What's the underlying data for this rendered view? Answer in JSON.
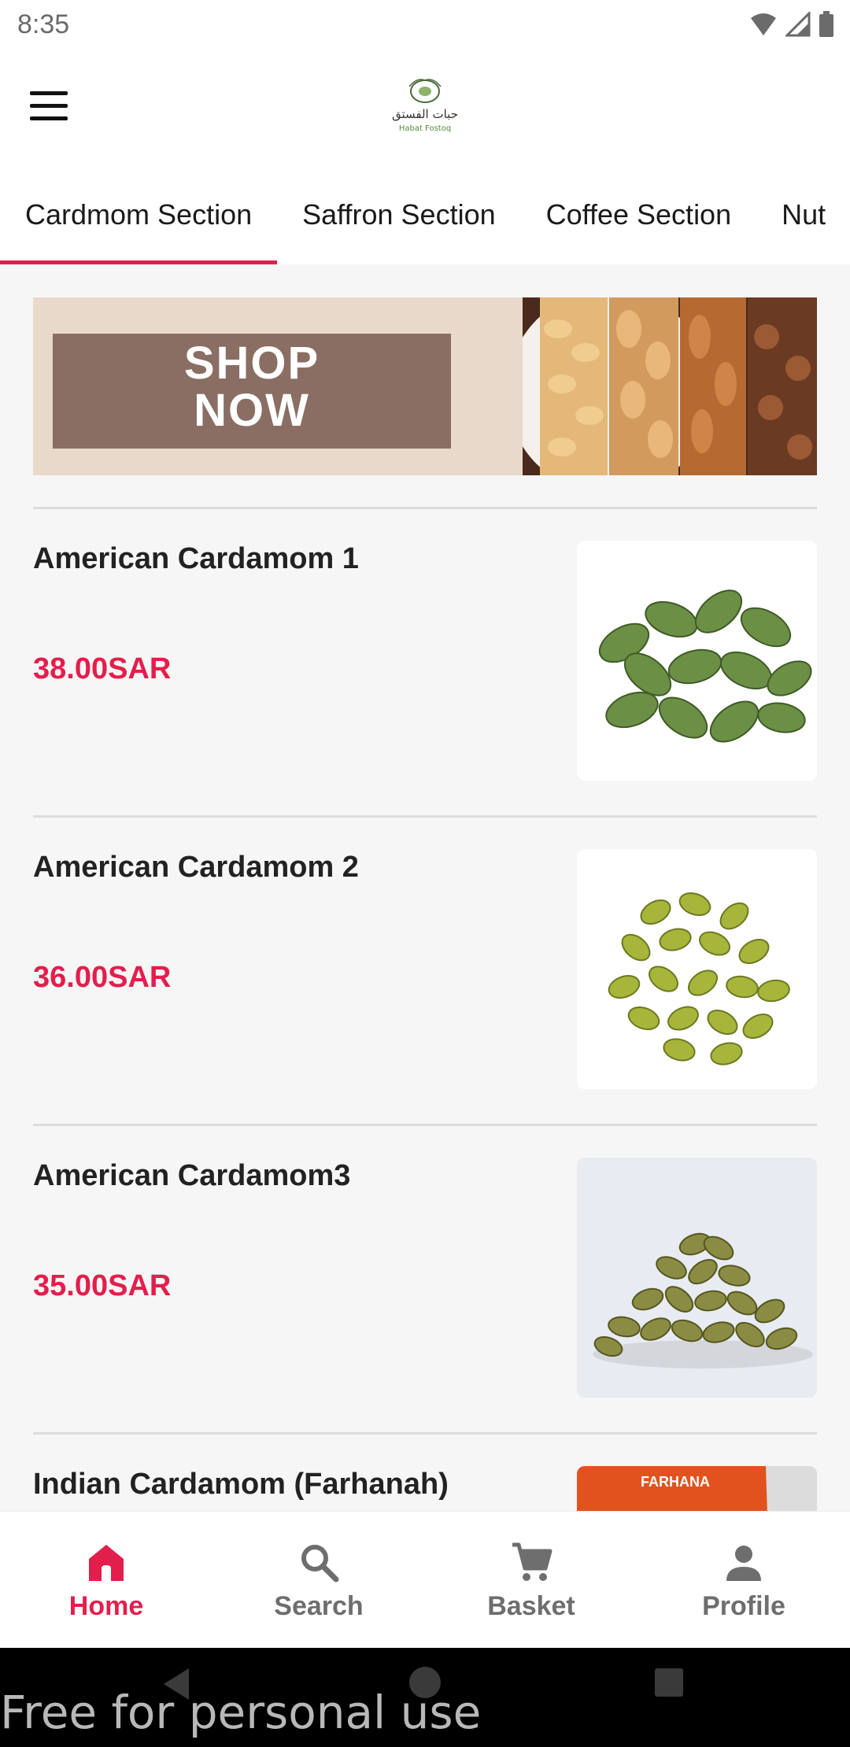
{
  "status_bar": {
    "time": "8:35"
  },
  "app_bar": {
    "logo_text_ar": "حبات الفستق",
    "logo_text_en": "Habat Fostoq"
  },
  "tabs": [
    {
      "label": "Cardmom Section",
      "active": true
    },
    {
      "label": "Saffron Section",
      "active": false
    },
    {
      "label": "Coffee Section",
      "active": false
    },
    {
      "label": "Nut",
      "active": false
    }
  ],
  "banner": {
    "line1": "SHOP",
    "line2": "NOW"
  },
  "products": [
    {
      "name": "American Cardamom 1",
      "price": "38.00SAR",
      "image": "green-cardamom-pods"
    },
    {
      "name": "American Cardamom 2",
      "price": "36.00SAR",
      "image": "yellow-green-cardamom-pods"
    },
    {
      "name": "American Cardamom3",
      "price": "35.00SAR",
      "image": "olive-cardamom-pile"
    },
    {
      "name": "Indian Cardamom (Farhanah)",
      "price": "",
      "image": "farhana-package",
      "package_label": "FARHANA"
    }
  ],
  "bottom_nav": [
    {
      "label": "Home",
      "icon": "home-icon",
      "active": true
    },
    {
      "label": "Search",
      "icon": "search-icon",
      "active": false
    },
    {
      "label": "Basket",
      "icon": "cart-icon",
      "active": false
    },
    {
      "label": "Profile",
      "icon": "person-icon",
      "active": false
    }
  ],
  "watermark": "Free for personal use",
  "colors": {
    "accent": "#e21f4c",
    "banner_bg": "#e8d9cb",
    "banner_box": "#8a6e63"
  }
}
